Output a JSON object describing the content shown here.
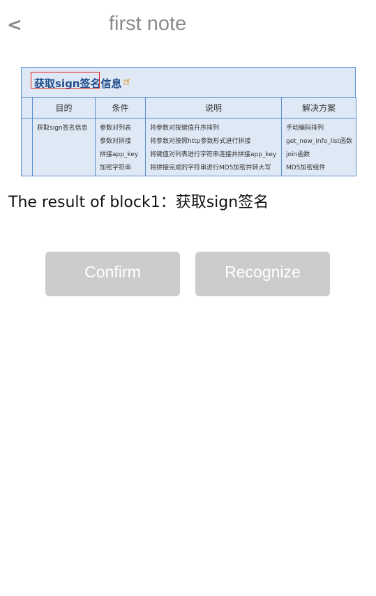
{
  "header": {
    "back_icon": "<",
    "title": "first note"
  },
  "document_image": {
    "heading": "获取sign签名信息",
    "table": {
      "columns": [
        "",
        "目的",
        "条件",
        "说明",
        "解决方案"
      ],
      "purpose": [
        "获取sign签名信息"
      ],
      "conditions": [
        "参数对列表",
        "参数对拼接",
        "拼接app_key",
        "加密字符串"
      ],
      "explanations": [
        "将参数对按键值升序排列",
        "将参数对按照http参数形式进行拼接",
        "将键值对列表进行字符串连接并拼接app_key",
        "将拼接完成的字符串进行MD5加密并转大写"
      ],
      "solutions": [
        "手动编码排列",
        "get_new_info_list函数",
        "join函数",
        "MD5加密组件"
      ]
    }
  },
  "result_text": "The result of block1：获取sign签名",
  "buttons": {
    "confirm": "Confirm",
    "recognize": "Recognize"
  },
  "colors": {
    "button_bg": "#cccccc",
    "table_border": "#5b8fd2",
    "table_bg": "#dfe8f5",
    "highlight": "#e02020"
  }
}
